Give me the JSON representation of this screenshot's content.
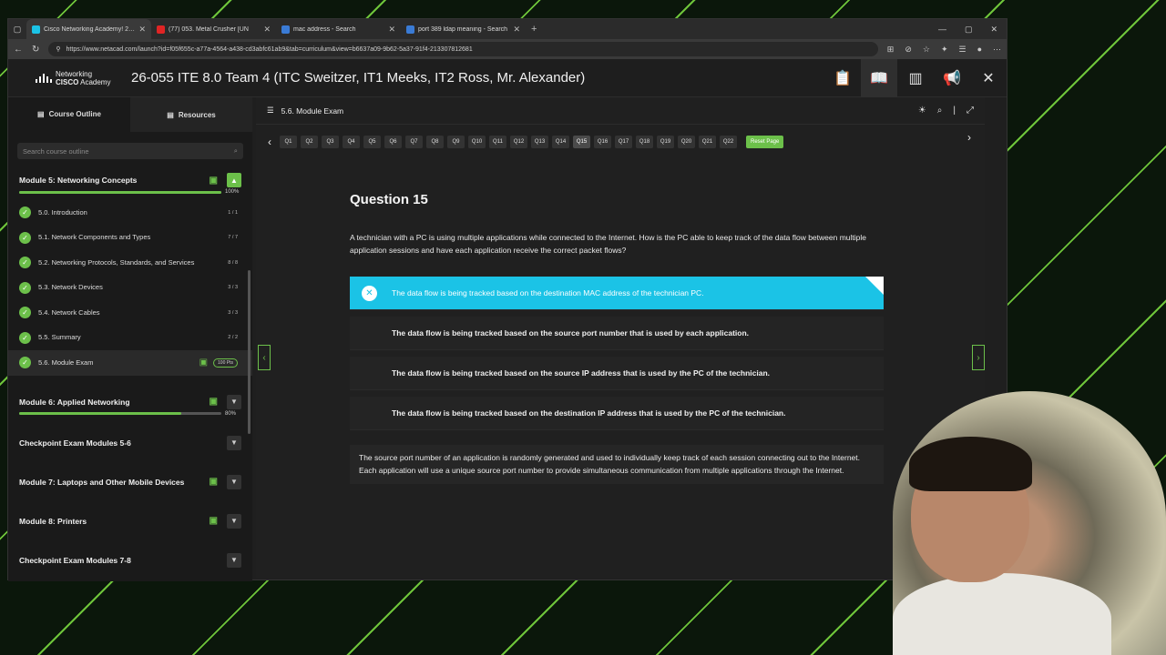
{
  "browser": {
    "tabs": [
      {
        "title": "Cisco Networking Academy! 26-0",
        "active": true,
        "fav_color": "#1bc3e6"
      },
      {
        "title": "(77) 053. Metal Crusher [UN",
        "active": false,
        "fav_color": "#e02424"
      },
      {
        "title": "mac address - Search",
        "active": false,
        "fav_color": "#3a7bd5"
      },
      {
        "title": "port 389 ldap meaning - Search",
        "active": false,
        "fav_color": "#3a7bd5"
      }
    ],
    "url": "https://www.netacad.com/launch?id=f05f655c-a77a-4564-a438-cd3abfc61ab9&tab=curriculum&view=b6637a09-9b62-5a37-91f4-213307812681"
  },
  "header": {
    "logo_line1": "Networking",
    "logo_line2": "Academy",
    "logo_brand": "CISCO",
    "course_title": "26-055 ITE 8.0 Team 4 (ITC Sweitzer, IT1 Meeks, IT2 Ross, Mr. Alexander)"
  },
  "sidebar": {
    "tabs": [
      "Course Outline",
      "Resources"
    ],
    "search_placeholder": "Search course outline",
    "module5": {
      "title": "Module 5: Networking Concepts",
      "pct": "100%",
      "progress": 1.0,
      "lessons": [
        {
          "label": "5.0. Introduction",
          "count": "1 / 1"
        },
        {
          "label": "5.1. Network Components and Types",
          "count": "7 / 7"
        },
        {
          "label": "5.2. Networking Protocols, Standards, and Services",
          "count": "8 / 8"
        },
        {
          "label": "5.3. Network Devices",
          "count": "3 / 3"
        },
        {
          "label": "5.4. Network Cables",
          "count": "3 / 3"
        },
        {
          "label": "5.5. Summary",
          "count": "2 / 2"
        },
        {
          "label": "5.6. Module Exam",
          "count": "100 Pts"
        }
      ]
    },
    "module6": {
      "title": "Module 6: Applied Networking",
      "pct": "80%",
      "progress": 0.8
    },
    "other_modules": [
      "Checkpoint Exam Modules 5-6",
      "Module 7: Laptops and Other Mobile Devices",
      "Module 8: Printers",
      "Checkpoint Exam Modules 7-8"
    ]
  },
  "exam": {
    "title": "5.6. Module Exam",
    "questions": [
      "Q1",
      "Q2",
      "Q3",
      "Q4",
      "Q5",
      "Q6",
      "Q7",
      "Q8",
      "Q9",
      "Q10",
      "Q11",
      "Q12",
      "Q13",
      "Q14",
      "Q15",
      "Q16",
      "Q17",
      "Q18",
      "Q19",
      "Q20",
      "Q21",
      "Q22"
    ],
    "current": "Q15",
    "reset_label": "Reset Page",
    "question_title": "Question 15",
    "question_text": "A technician with a PC is using multiple applications while connected to the Internet. How is the PC able to keep track of the data flow between multiple application sessions and have each application receive the correct packet flows?",
    "options": [
      "The data flow is being tracked based on the destination MAC address of the technician PC.",
      "The data flow is being tracked based on the source port number that is used by each application.",
      "The data flow is being tracked based on the source IP address that is used by the PC of the technician.",
      "The data flow is being tracked based on the destination IP address that is used by the PC of the technician."
    ],
    "selected_index": 0,
    "feedback": "The source port number of an application is randomly generated and used to individually keep track of each session connecting out to the Internet. Each application will use a unique source port number to provide simultaneous communication from multiple applications through the Internet."
  },
  "colors": {
    "accent_green": "#6cc04a",
    "selected_blue": "#1bc3e6"
  }
}
